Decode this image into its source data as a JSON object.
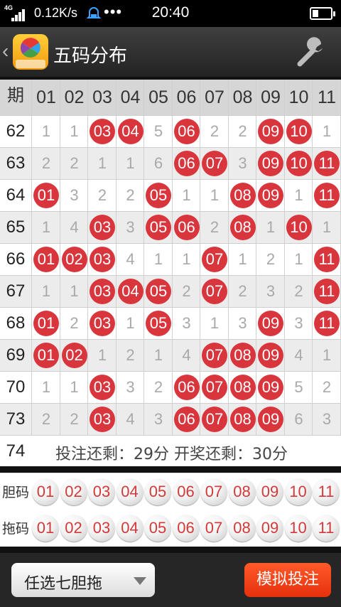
{
  "status_bar": {
    "network": "4G",
    "speed": "0.12K/s",
    "more": "•••",
    "time": "20:40"
  },
  "header": {
    "title": "五码分布",
    "logo_text": "快 彩"
  },
  "table": {
    "period_header": "期号",
    "columns": [
      "01",
      "02",
      "03",
      "04",
      "05",
      "06",
      "07",
      "08",
      "09",
      "10",
      "11"
    ],
    "rows": [
      {
        "issue": "62",
        "values": [
          "1",
          "1",
          "03",
          "04",
          "5",
          "06",
          "2",
          "2",
          "09",
          "10",
          "1"
        ],
        "hits": [
          false,
          false,
          true,
          true,
          false,
          true,
          false,
          false,
          true,
          true,
          false
        ]
      },
      {
        "issue": "63",
        "values": [
          "2",
          "2",
          "1",
          "1",
          "6",
          "06",
          "07",
          "3",
          "09",
          "10",
          "11"
        ],
        "hits": [
          false,
          false,
          false,
          false,
          false,
          true,
          true,
          false,
          true,
          true,
          true
        ]
      },
      {
        "issue": "64",
        "values": [
          "01",
          "3",
          "2",
          "2",
          "05",
          "1",
          "1",
          "08",
          "09",
          "1",
          "11"
        ],
        "hits": [
          true,
          false,
          false,
          false,
          true,
          false,
          false,
          true,
          true,
          false,
          true
        ]
      },
      {
        "issue": "65",
        "values": [
          "1",
          "4",
          "03",
          "3",
          "05",
          "06",
          "2",
          "08",
          "1",
          "10",
          "1"
        ],
        "hits": [
          false,
          false,
          true,
          false,
          true,
          true,
          false,
          true,
          false,
          true,
          false
        ]
      },
      {
        "issue": "66",
        "values": [
          "01",
          "02",
          "03",
          "4",
          "1",
          "1",
          "07",
          "1",
          "2",
          "1",
          "11"
        ],
        "hits": [
          true,
          true,
          true,
          false,
          false,
          false,
          true,
          false,
          false,
          false,
          true
        ]
      },
      {
        "issue": "67",
        "values": [
          "1",
          "1",
          "03",
          "04",
          "05",
          "2",
          "07",
          "2",
          "3",
          "2",
          "11"
        ],
        "hits": [
          false,
          false,
          true,
          true,
          true,
          false,
          true,
          false,
          false,
          false,
          true
        ]
      },
      {
        "issue": "68",
        "values": [
          "01",
          "2",
          "03",
          "1",
          "05",
          "3",
          "1",
          "3",
          "09",
          "3",
          "11"
        ],
        "hits": [
          true,
          false,
          true,
          false,
          true,
          false,
          false,
          false,
          true,
          false,
          true
        ]
      },
      {
        "issue": "69",
        "values": [
          "01",
          "02",
          "1",
          "2",
          "1",
          "4",
          "07",
          "08",
          "09",
          "4",
          "1"
        ],
        "hits": [
          true,
          true,
          false,
          false,
          false,
          false,
          true,
          true,
          true,
          false,
          false
        ]
      },
      {
        "issue": "70",
        "values": [
          "1",
          "1",
          "03",
          "3",
          "2",
          "06",
          "07",
          "08",
          "09",
          "5",
          "2"
        ],
        "hits": [
          false,
          false,
          true,
          false,
          false,
          true,
          true,
          true,
          true,
          false,
          false
        ]
      },
      {
        "issue": "73",
        "values": [
          "2",
          "2",
          "03",
          "4",
          "3",
          "06",
          "07",
          "08",
          "09",
          "6",
          "3"
        ],
        "hits": [
          false,
          false,
          true,
          false,
          false,
          true,
          true,
          true,
          true,
          false,
          false
        ]
      }
    ],
    "current_issue": "74",
    "countdown": "投注还剩：29分 开奖还剩：30分"
  },
  "dan_row": {
    "label": "胆码",
    "balls": [
      "01",
      "02",
      "03",
      "04",
      "05",
      "06",
      "07",
      "08",
      "09",
      "10",
      "11"
    ]
  },
  "tuo_row": {
    "label": "拖码",
    "balls": [
      "01",
      "02",
      "03",
      "04",
      "05",
      "06",
      "07",
      "08",
      "09",
      "10",
      "11"
    ]
  },
  "bottom_bar": {
    "mode_label": "任选七胆拖",
    "simulate_label": "模拟投注"
  },
  "colors": {
    "hit_ball": "#d9353d",
    "simulate_button": "#f0441a",
    "header_bg": "#333333"
  }
}
